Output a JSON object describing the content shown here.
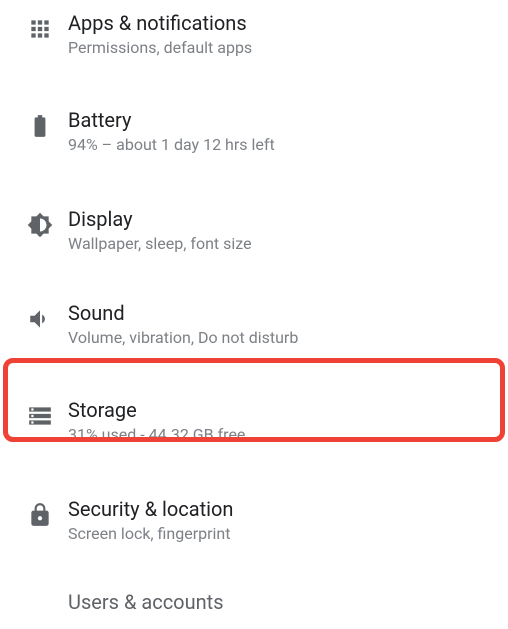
{
  "settings": [
    {
      "key": "apps",
      "title": "Apps & notifications",
      "subtitle": "Permissions, default apps"
    },
    {
      "key": "battery",
      "title": "Battery",
      "subtitle": "94% – about 1 day 12 hrs left"
    },
    {
      "key": "display",
      "title": "Display",
      "subtitle": "Wallpaper, sleep, font size"
    },
    {
      "key": "sound",
      "title": "Sound",
      "subtitle": "Volume, vibration, Do not disturb"
    },
    {
      "key": "storage",
      "title": "Storage",
      "subtitle": "31% used - 44.32 GB free"
    },
    {
      "key": "security",
      "title": "Security & location",
      "subtitle": "Screen lock, fingerprint"
    },
    {
      "key": "users",
      "title": "Users & accounts",
      "subtitle": ""
    }
  ],
  "highlight": {
    "target": "storage",
    "color": "#ef4135"
  }
}
